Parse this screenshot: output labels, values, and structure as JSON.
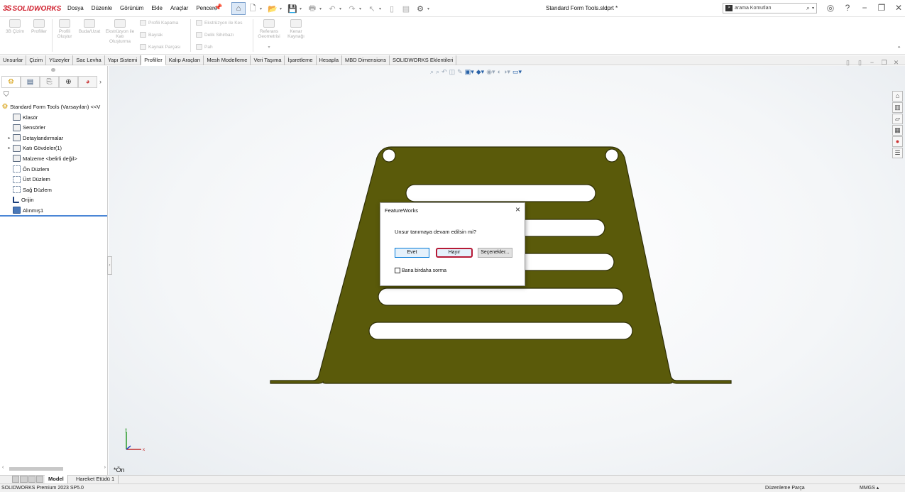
{
  "app": {
    "brand": "SOLIDWORKS",
    "brand_prefix": "3S",
    "document_title": "Standard Form Tools.sldprt *",
    "menu": [
      "Dosya",
      "Düzenle",
      "Görünüm",
      "Ekle",
      "Araçlar",
      "Pencere"
    ],
    "search_placeholder": "arama Komutları"
  },
  "ribbon": {
    "big_buttons": [
      "3B Çizim",
      "Profiller",
      "Profili Oluştur",
      "Buda/Uzat",
      "Ekstrüzyon ile Katı Oluşturma",
      "Referans Geometrisi",
      "Kenar Kaynağı"
    ],
    "small_col1": [
      "Profili Kapama",
      "Bayrak",
      "Kaynak Parçası"
    ],
    "small_col2": [
      "Ekstrüzyon ile Kes",
      "Delik Sihirbazı",
      "Pah"
    ]
  },
  "tabs": [
    "Unsurlar",
    "Çizim",
    "Yüzeyler",
    "Sac Levha",
    "Yapı Sistemi",
    "Profiller",
    "Kalıp Araçları",
    "Mesh Modelleme",
    "Veri Taşıma",
    "İşaretleme",
    "Hesapla",
    "MBD Dimensions",
    "SOLIDWORKS Eklentileri"
  ],
  "active_tab": "Profiller",
  "tree": {
    "root": "Standard Form Tools (Varsayılan) <<V",
    "items": [
      {
        "label": "Klasör",
        "expand": false
      },
      {
        "label": "Sensörler",
        "expand": false
      },
      {
        "label": "Detaylandırmalar",
        "expand": true
      },
      {
        "label": "Katı Gövdeler(1)",
        "expand": true
      },
      {
        "label": "Malzeme <belirli değil>",
        "expand": false
      },
      {
        "label": "Ön Düzlem",
        "expand": false
      },
      {
        "label": "Üst Düzlem",
        "expand": false
      },
      {
        "label": "Sağ Düzlem",
        "expand": false
      },
      {
        "label": "Orijin",
        "expand": false
      },
      {
        "label": "Alınmış1",
        "expand": false
      }
    ]
  },
  "viewport": {
    "view_label": "*Ön",
    "part_color": "#5a5a0a",
    "part_edge": "#2e2e06",
    "axis_x": "x",
    "axis_y": "y"
  },
  "dialog": {
    "title": "FeatureWorks",
    "message": "Unsur tanımaya devam edilsin mi?",
    "buttons": {
      "yes": "Evet",
      "no": "Hayır",
      "options": "Seçenekler..."
    },
    "checkbox_label": "Bana birdaha sorma",
    "checkbox_checked": false
  },
  "bottom_tabs": [
    "Model",
    "Hareket Etüdü 1"
  ],
  "status": {
    "left": "SOLIDWORKS Premium 2023 SP5.0",
    "mode": "Düzenleme Parça",
    "units": "MMGS"
  }
}
